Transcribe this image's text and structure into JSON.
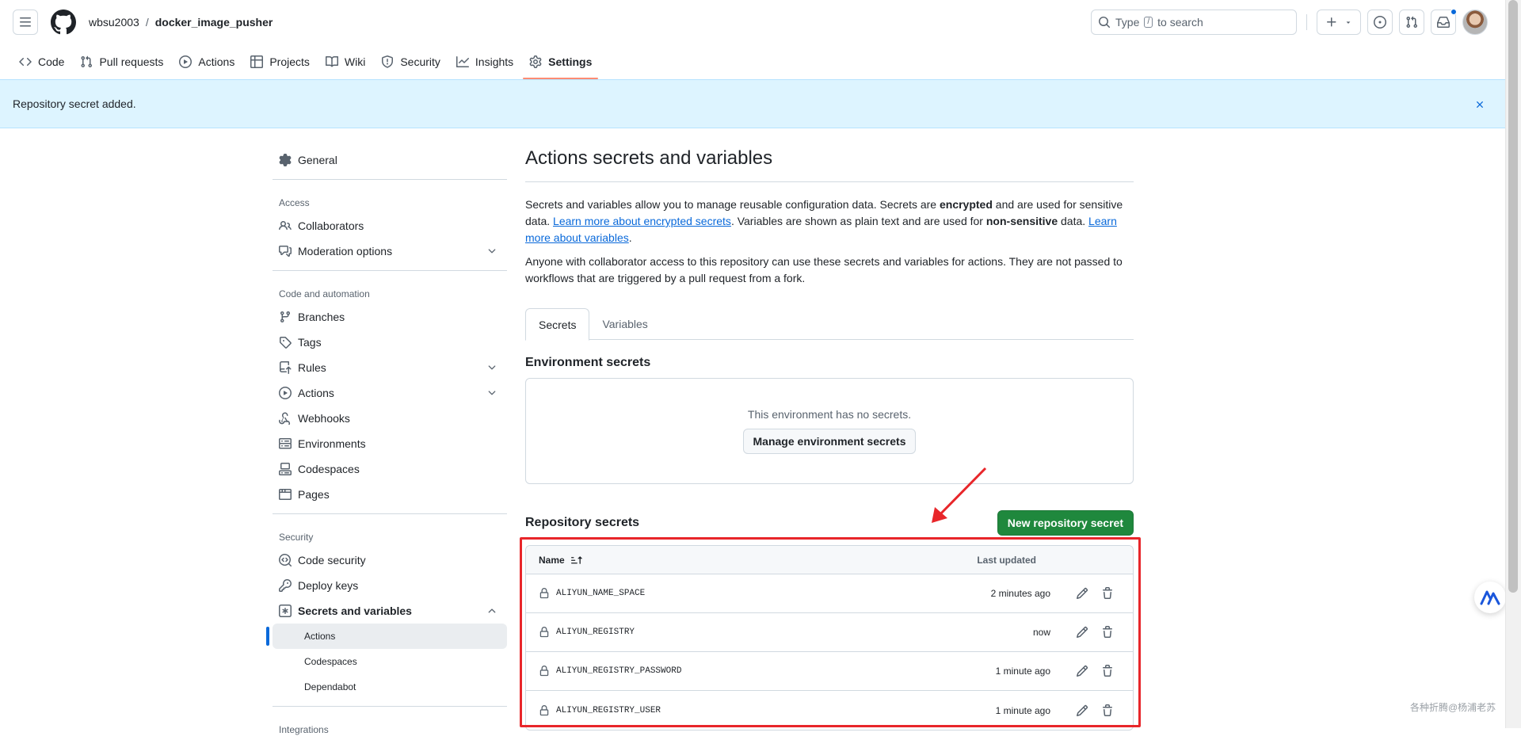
{
  "header": {
    "owner": "wbsu2003",
    "separator": "/",
    "repo": "docker_image_pusher",
    "search_placeholder_pre": "Type",
    "search_key": "/",
    "search_placeholder_post": "to search"
  },
  "nav": {
    "items": [
      {
        "label": "Code",
        "icon": "code-icon"
      },
      {
        "label": "Pull requests",
        "icon": "git-pull-request-icon"
      },
      {
        "label": "Actions",
        "icon": "play-icon"
      },
      {
        "label": "Projects",
        "icon": "table-icon"
      },
      {
        "label": "Wiki",
        "icon": "book-icon"
      },
      {
        "label": "Security",
        "icon": "shield-icon"
      },
      {
        "label": "Insights",
        "icon": "graph-icon"
      },
      {
        "label": "Settings",
        "icon": "gear-icon",
        "active": true
      }
    ]
  },
  "flash": {
    "message": "Repository secret added."
  },
  "sidebar": {
    "general": "General",
    "access_heading": "Access",
    "collaborators": "Collaborators",
    "moderation": "Moderation options",
    "code_heading": "Code and automation",
    "branches": "Branches",
    "tags": "Tags",
    "rules": "Rules",
    "actions": "Actions",
    "webhooks": "Webhooks",
    "environments": "Environments",
    "codespaces": "Codespaces",
    "pages": "Pages",
    "security_heading": "Security",
    "code_security": "Code security",
    "deploy_keys": "Deploy keys",
    "secrets_vars": "Secrets and variables",
    "sub_actions": "Actions",
    "sub_codespaces": "Codespaces",
    "sub_dependabot": "Dependabot",
    "integrations_heading": "Integrations"
  },
  "main": {
    "title": "Actions secrets and variables",
    "desc_1": "Secrets and variables allow you to manage reusable configuration data. Secrets are ",
    "desc_bold_1": "encrypted",
    "desc_2": " and are used for sensitive data. ",
    "desc_link_1": "Learn more about encrypted secrets",
    "desc_3": ". Variables are shown as plain text and are used for ",
    "desc_bold_2": "non-sensitive",
    "desc_4": " data. ",
    "desc_link_2": "Learn more about variables",
    "desc_5": ".",
    "desc_para2": "Anyone with collaborator access to this repository can use these secrets and variables for actions. They are not passed to workflows that are triggered by a pull request from a fork.",
    "tabs": [
      "Secrets",
      "Variables"
    ],
    "env_heading": "Environment secrets",
    "env_empty": "This environment has no secrets.",
    "env_button": "Manage environment secrets",
    "repo_heading": "Repository secrets",
    "new_button": "New repository secret",
    "col_name": "Name",
    "col_updated": "Last updated",
    "secrets": [
      {
        "name": "ALIYUN_NAME_SPACE",
        "updated": "2 minutes ago"
      },
      {
        "name": "ALIYUN_REGISTRY",
        "updated": "now"
      },
      {
        "name": "ALIYUN_REGISTRY_PASSWORD",
        "updated": "1 minute ago"
      },
      {
        "name": "ALIYUN_REGISTRY_USER",
        "updated": "1 minute ago"
      }
    ]
  },
  "watermark": "各种折腾@杨浦老苏",
  "colors": {
    "accent": "#0969da",
    "green_button": "#1f883d",
    "flash_bg": "#ddf4ff",
    "annotation_red": "#e8262a",
    "active_tab_underline": "#fd8c73"
  }
}
